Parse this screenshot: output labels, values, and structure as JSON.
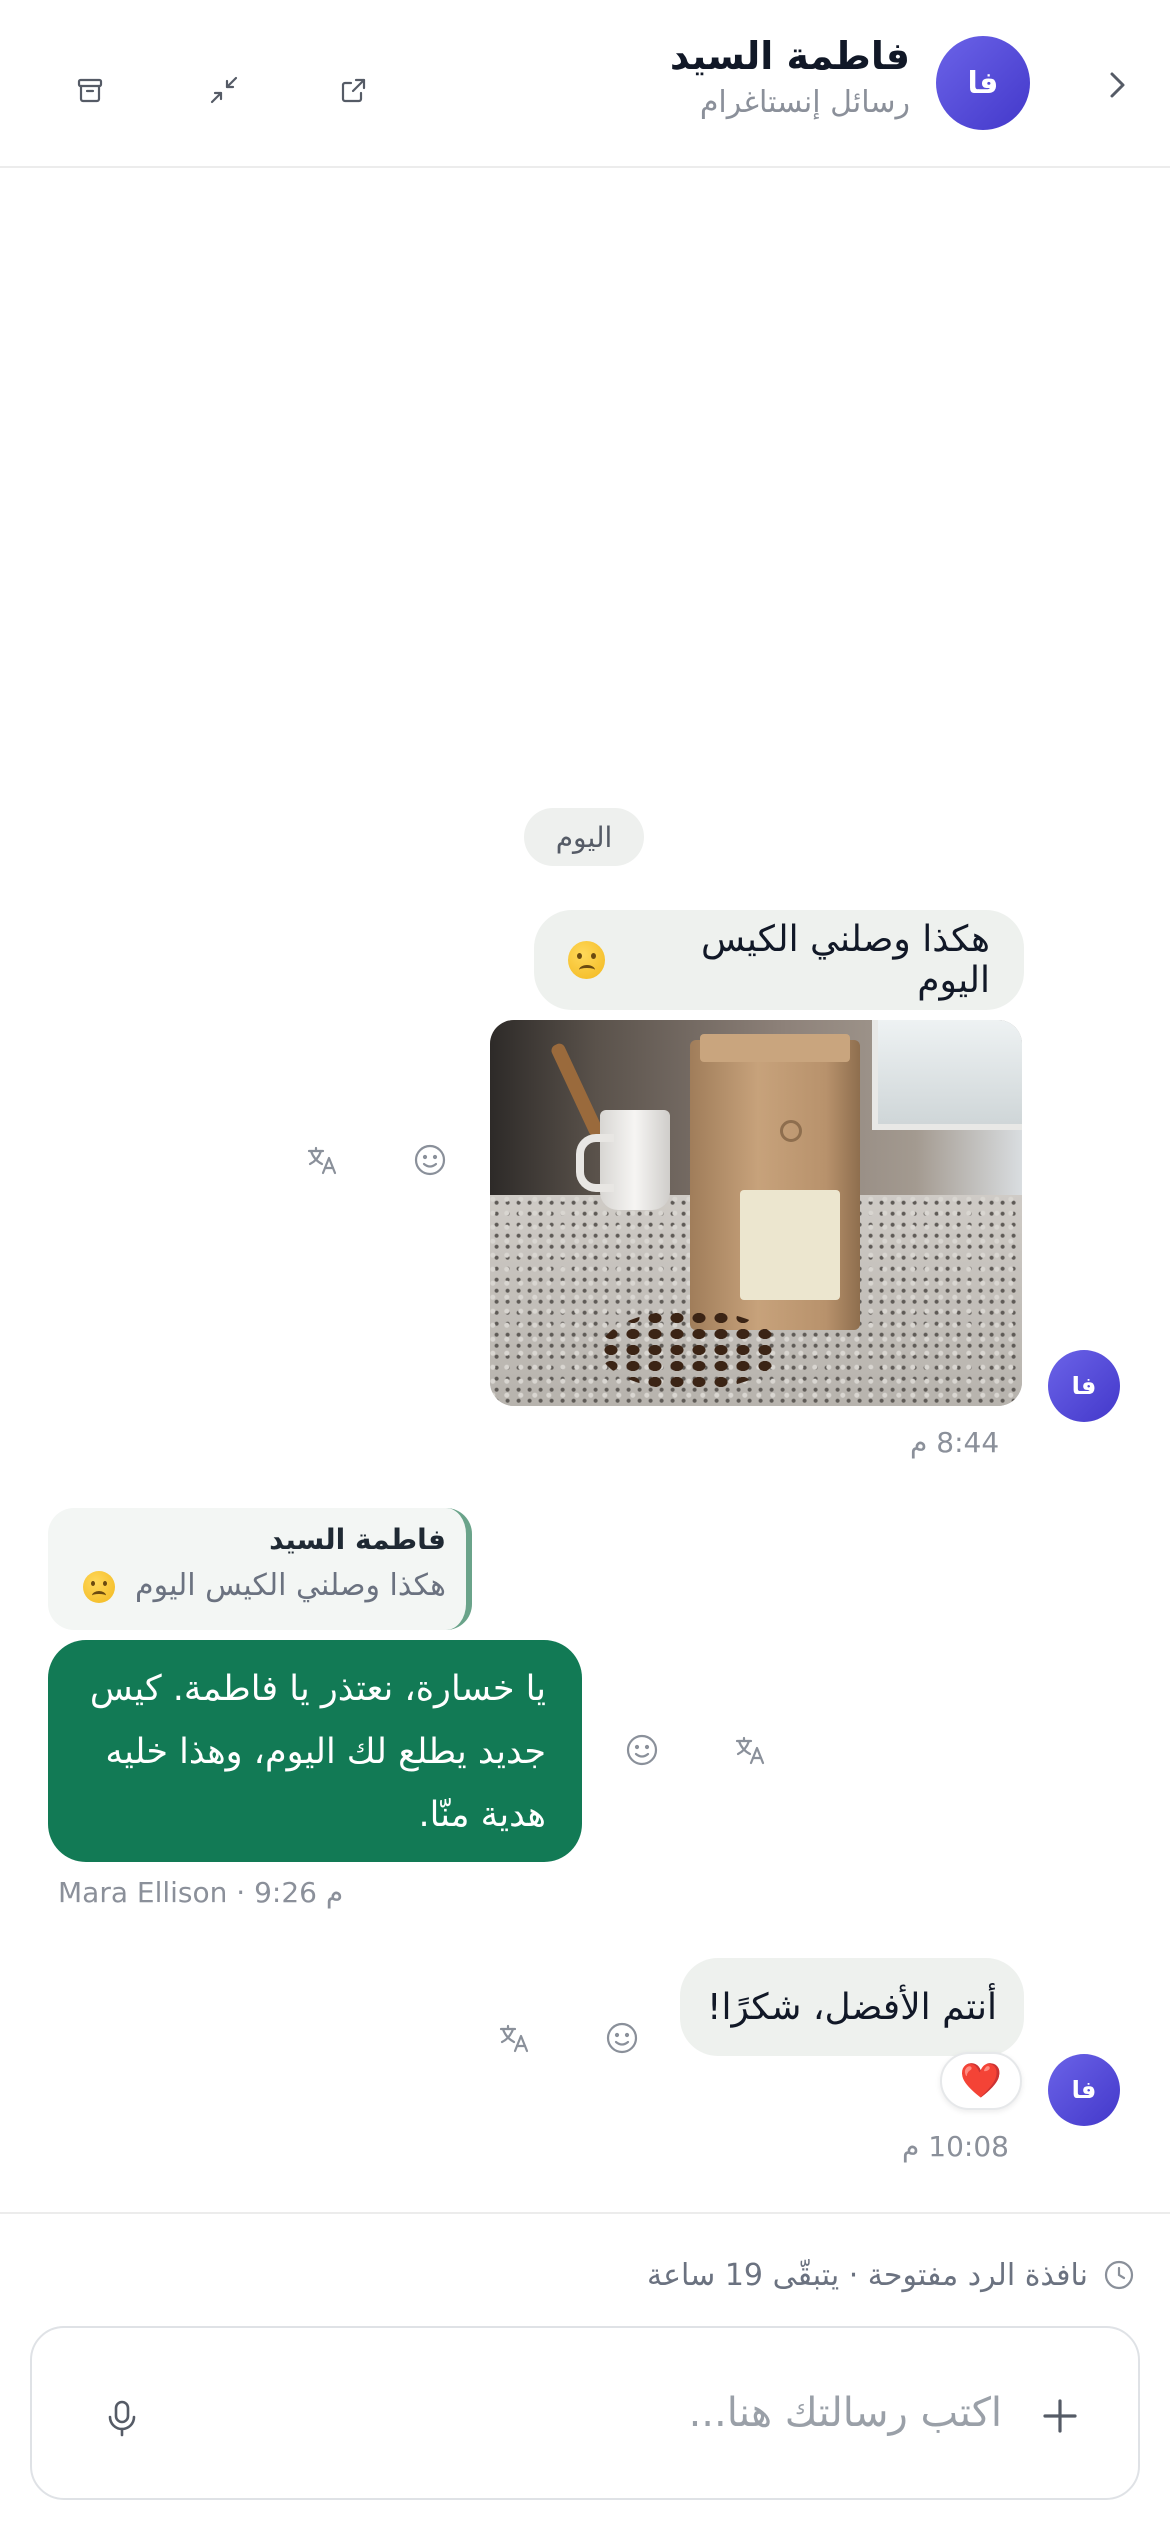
{
  "header": {
    "contact_name": "فاطمة السيد",
    "channel": "رسائل إنستاغرام",
    "avatar_initials": "فا"
  },
  "chat": {
    "day_separator": "اليوم",
    "messages": [
      {
        "direction": "incoming",
        "text": "هكذا وصلني الكيس اليوم",
        "emoji": "slightly-frowning-face",
        "has_image": true,
        "time": "8:44 م"
      },
      {
        "direction": "outgoing",
        "reply_to_name": "فاطمة السيد",
        "reply_to_text": "هكذا وصلني الكيس اليوم",
        "lines": [
          "يا خسارة، نعتذر يا فاطمة. كيس",
          "جديد يطلع لك اليوم، وهذا خليه",
          "هدية منّا."
        ],
        "meta": "Mara Ellison · 9:26 م"
      },
      {
        "direction": "incoming",
        "text": "أنتم الأفضل، شكرًا!",
        "reaction": "❤️",
        "time": "10:08 م"
      }
    ]
  },
  "footer": {
    "reply_window": "نافذة الرد مفتوحة · يتبقّى 19 ساعة",
    "input_placeholder": "اكتب رسالتك هنا..."
  },
  "colors": {
    "accent_green": "#127a55",
    "avatar": "#4f46e5",
    "incoming_bubble": "#eef1ee"
  },
  "icons": [
    "archive-icon",
    "minimize-icon",
    "external-link-icon",
    "chevron-right-icon",
    "translate-icon",
    "smiley-icon",
    "clock-icon",
    "plus-icon",
    "microphone-icon"
  ]
}
